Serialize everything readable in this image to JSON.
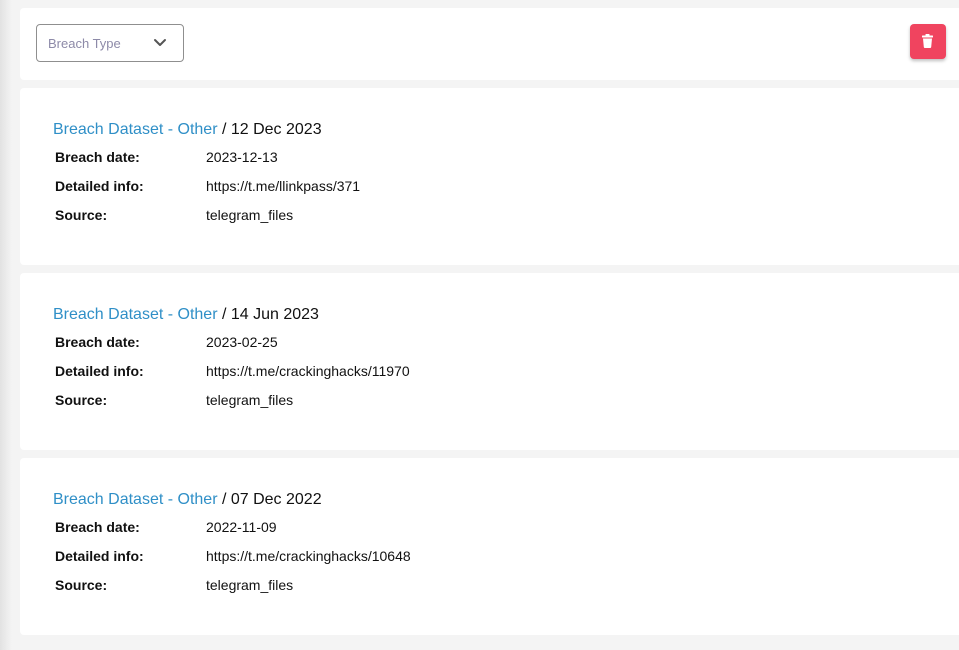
{
  "filter": {
    "breach_type_placeholder": "Breach Type",
    "chevron_icon": "chevron-down-icon"
  },
  "actions": {
    "delete_icon": "trash-icon",
    "delete_color": "#f0445f"
  },
  "labels": {
    "breach_date": "Breach date:",
    "detailed_info": "Detailed info:",
    "source": "Source:"
  },
  "accent_color": "#2f8fc7",
  "records": [
    {
      "dataset": "Breach Dataset - Other",
      "separator": " / ",
      "date": "12 Dec 2023",
      "breach_date": "2023-12-13",
      "detailed_info": "https://t.me/llinkpass/371",
      "source": "telegram_files"
    },
    {
      "dataset": "Breach Dataset - Other",
      "separator": " / ",
      "date": "14 Jun 2023",
      "breach_date": "2023-02-25",
      "detailed_info": "https://t.me/crackinghacks/11970",
      "source": "telegram_files"
    },
    {
      "dataset": "Breach Dataset - Other",
      "separator": " / ",
      "date": "07 Dec 2022",
      "breach_date": "2022-11-09",
      "detailed_info": "https://t.me/crackinghacks/10648",
      "source": "telegram_files"
    }
  ]
}
